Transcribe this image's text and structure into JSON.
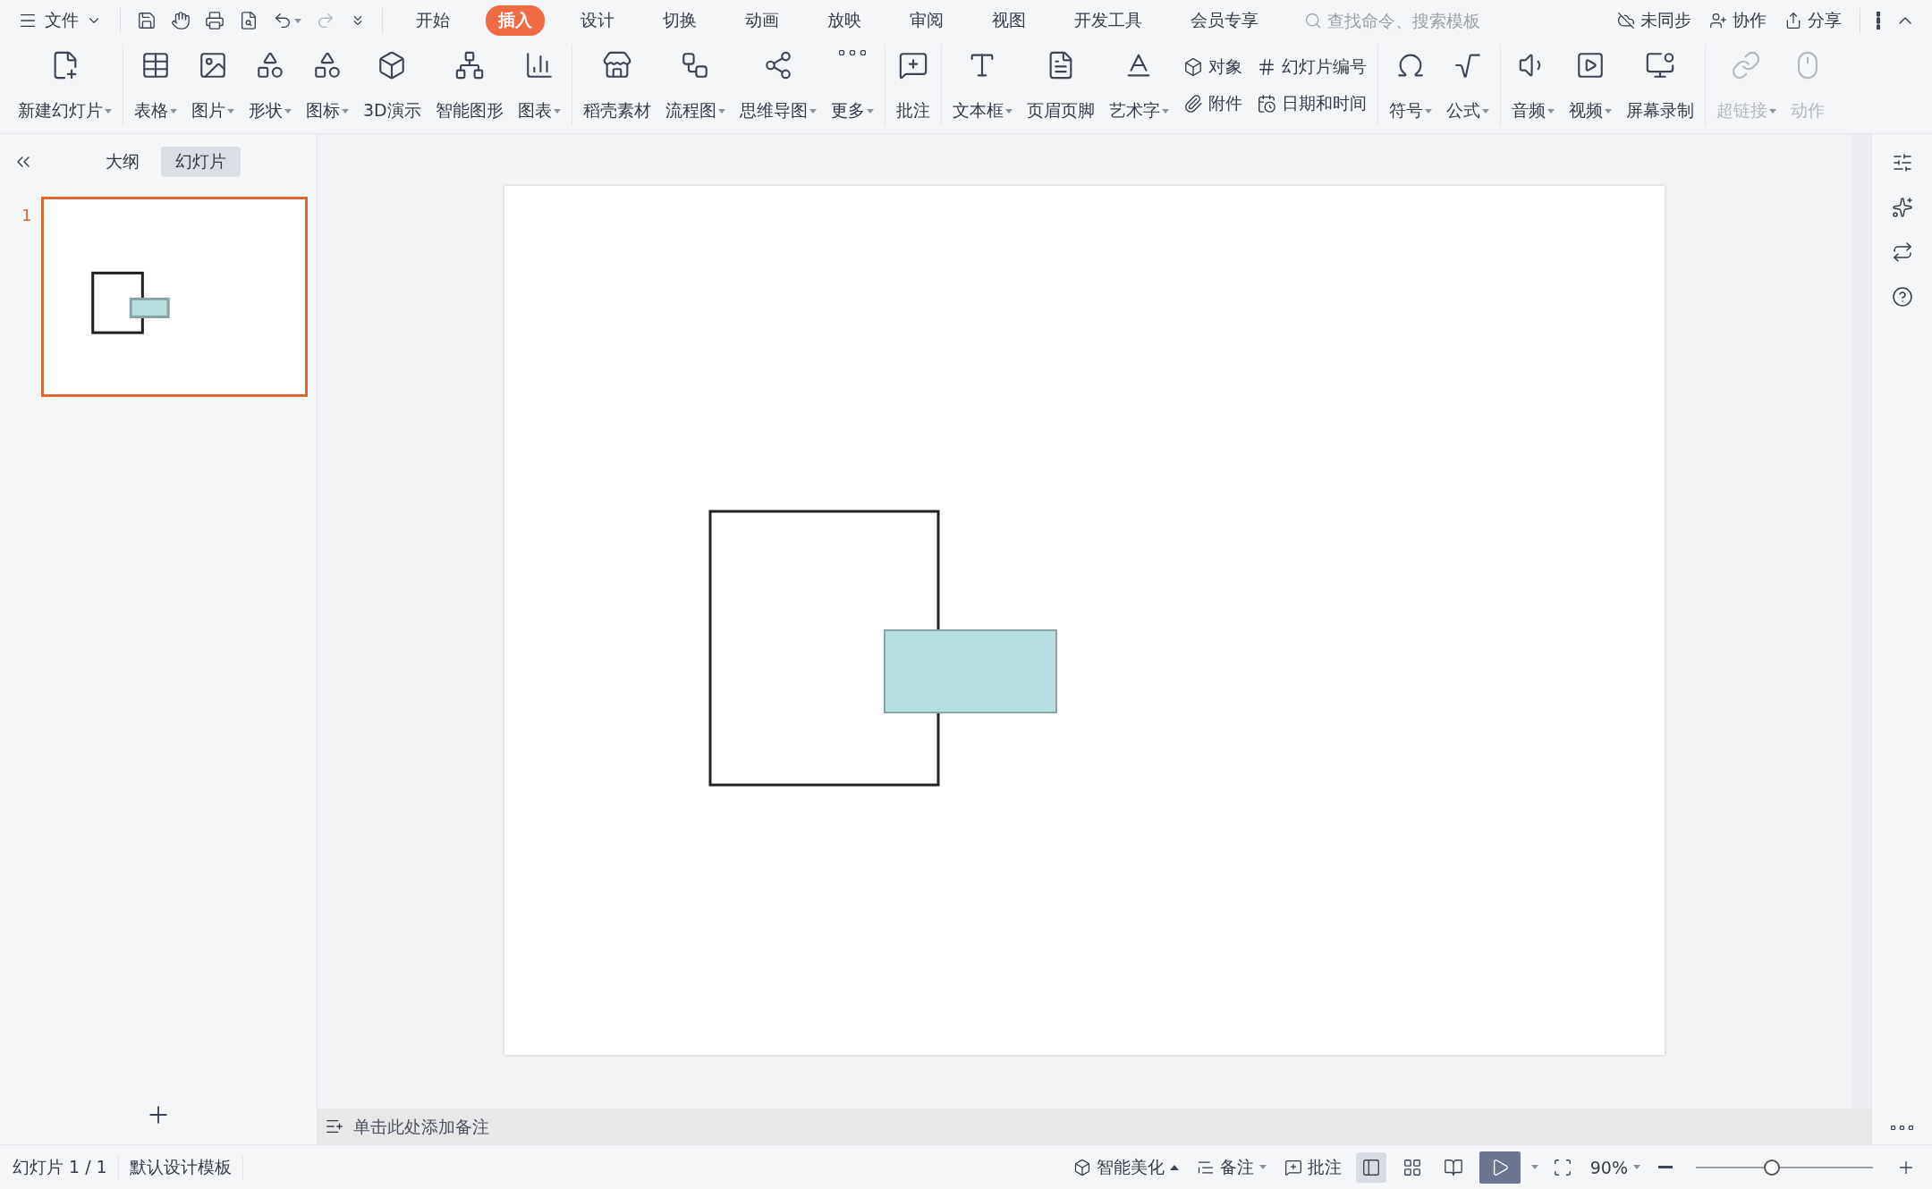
{
  "title_bar": {
    "file_menu": "文件",
    "tabs": [
      {
        "label": "开始",
        "selected": false
      },
      {
        "label": "插入",
        "selected": true
      },
      {
        "label": "设计",
        "selected": false
      },
      {
        "label": "切换",
        "selected": false
      },
      {
        "label": "动画",
        "selected": false
      },
      {
        "label": "放映",
        "selected": false
      },
      {
        "label": "审阅",
        "selected": false
      },
      {
        "label": "视图",
        "selected": false
      },
      {
        "label": "开发工具",
        "selected": false
      },
      {
        "label": "会员专享",
        "selected": false
      }
    ],
    "search": {
      "placeholder": "查找命令、搜索模板"
    },
    "actions": [
      "未同步",
      "协作",
      "分享"
    ]
  },
  "ribbon": {
    "groups": [
      [
        {
          "kind": "large",
          "label": "新建幻灯片",
          "dropdown": true,
          "disabled": false
        }
      ],
      [
        {
          "kind": "large",
          "label": "表格",
          "dropdown": true,
          "disabled": false
        },
        {
          "kind": "large",
          "label": "图片",
          "dropdown": true,
          "disabled": false
        },
        {
          "kind": "large",
          "label": "形状",
          "dropdown": true,
          "disabled": false
        },
        {
          "kind": "large",
          "label": "图标",
          "dropdown": true,
          "disabled": false
        },
        {
          "kind": "large",
          "label": "3D演示",
          "dropdown": false,
          "disabled": false
        },
        {
          "kind": "large",
          "label": "智能图形",
          "dropdown": false,
          "disabled": false
        },
        {
          "kind": "large",
          "label": "图表",
          "dropdown": true,
          "disabled": false
        }
      ],
      [
        {
          "kind": "large",
          "label": "稻壳素材",
          "dropdown": false,
          "disabled": false
        },
        {
          "kind": "large",
          "label": "流程图",
          "dropdown": true,
          "disabled": false
        },
        {
          "kind": "large",
          "label": "思维导图",
          "dropdown": true,
          "disabled": false
        },
        {
          "kind": "large",
          "label": "更多",
          "dropdown": true,
          "disabled": false
        }
      ],
      [
        {
          "kind": "large",
          "label": "批注",
          "dropdown": false,
          "disabled": false
        }
      ],
      [
        {
          "kind": "large",
          "label": "文本框",
          "dropdown": true,
          "disabled": false
        },
        {
          "kind": "large",
          "label": "页眉页脚",
          "dropdown": false,
          "disabled": false
        },
        {
          "kind": "large",
          "label": "艺术字",
          "dropdown": true,
          "disabled": false
        },
        {
          "kind": "pair",
          "items": [
            {
              "label": "对象",
              "disabled": false
            },
            {
              "label": "附件",
              "disabled": false
            }
          ]
        },
        {
          "kind": "pair",
          "items": [
            {
              "label": "幻灯片编号",
              "disabled": false
            },
            {
              "label": "日期和时间",
              "disabled": false
            }
          ]
        }
      ],
      [
        {
          "kind": "large",
          "label": "符号",
          "dropdown": true,
          "disabled": false
        },
        {
          "kind": "large",
          "label": "公式",
          "dropdown": true,
          "disabled": false
        }
      ],
      [
        {
          "kind": "large",
          "label": "音频",
          "dropdown": true,
          "disabled": false
        },
        {
          "kind": "large",
          "label": "视频",
          "dropdown": true,
          "disabled": false
        },
        {
          "kind": "large",
          "label": "屏幕录制",
          "dropdown": false,
          "disabled": false
        }
      ],
      [
        {
          "kind": "large",
          "label": "超链接",
          "dropdown": true,
          "disabled": true
        },
        {
          "kind": "large",
          "label": "动作",
          "dropdown": false,
          "disabled": true
        }
      ]
    ]
  },
  "left_panel": {
    "tabs": [
      {
        "label": "大纲",
        "selected": false
      },
      {
        "label": "幻灯片",
        "selected": true
      }
    ],
    "slides": [
      {
        "number": "1",
        "selected": true
      }
    ]
  },
  "slide": {
    "shapes": [
      {
        "kind": "rectangle",
        "color": "#ffffff"
      },
      {
        "kind": "rectangle",
        "color": "#b8dfe0"
      }
    ]
  },
  "notes": {
    "placeholder": "单击此处添加备注"
  },
  "status_bar": {
    "slide_count": "幻灯片 1 / 1",
    "template": "默认设计模板",
    "beautify": "智能美化",
    "notes": "备注",
    "comments": "批注",
    "view_buttons": [
      {
        "selected": true
      },
      {
        "selected": false
      },
      {
        "selected": false
      }
    ],
    "zoom": "90%",
    "zoom_slider": {
      "level": 0.43
    }
  }
}
